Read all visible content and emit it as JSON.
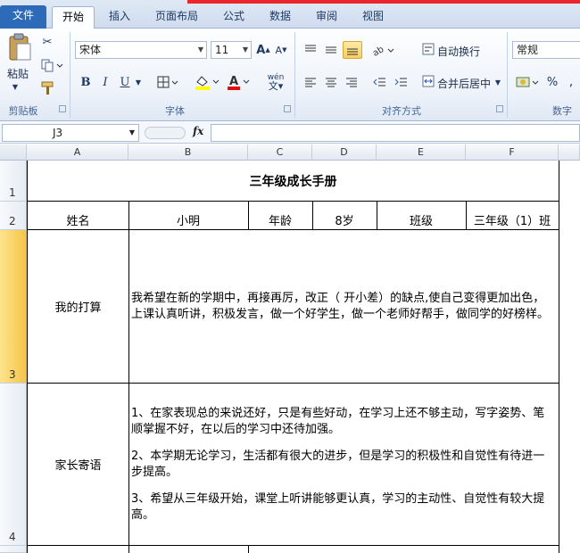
{
  "tabs": [
    "文件",
    "开始",
    "插入",
    "页面布局",
    "公式",
    "数据",
    "审阅",
    "视图"
  ],
  "clipboard": {
    "paste": "粘贴",
    "group": "剪贴板"
  },
  "font": {
    "name": "宋体",
    "size": "11",
    "bold": "B",
    "italic": "I",
    "underline": "U",
    "wen": "wén",
    "group": "字体"
  },
  "alignment": {
    "wrap": "自动换行",
    "merge": "合并后居中",
    "group": "对齐方式"
  },
  "number": {
    "format": "常规",
    "group": "数字"
  },
  "formula_bar": {
    "cell_ref": "J3",
    "fx": "fx",
    "content": ""
  },
  "columns": [
    "A",
    "B",
    "C",
    "D",
    "E",
    "F"
  ],
  "rows": [
    "1",
    "2",
    "3",
    "4"
  ],
  "sheet": {
    "title": "三年级成长手册",
    "row2": {
      "name_label": "姓名",
      "name_value": "小明",
      "age_label": "年龄",
      "age_value": "8岁",
      "class_label": "班级",
      "class_value": "三年级（1）班"
    },
    "row3": {
      "label": "我的打算",
      "text": "我希望在新的学期中，再接再厉，改正（ 开小差）的缺点,使自己变得更加出色，上课认真听讲，积极发言，做一个好学生，做一个老师好帮手，做同学的好榜样。"
    },
    "row4": {
      "label": "家长寄语",
      "p1": "1、在家表现总的来说还好，只是有些好动，在学习上还不够主动，写字姿势、笔顺掌握不好，在以后的学习中还待加强。",
      "p2": "2、本学期无论学习，生活都有很大的进步，但是学习的积极性和自觉性有待进一步提高。",
      "p3": "3、希望从三年级开始，课堂上听讲能够更认真，学习的主动性、自觉性有较大提高。"
    }
  }
}
